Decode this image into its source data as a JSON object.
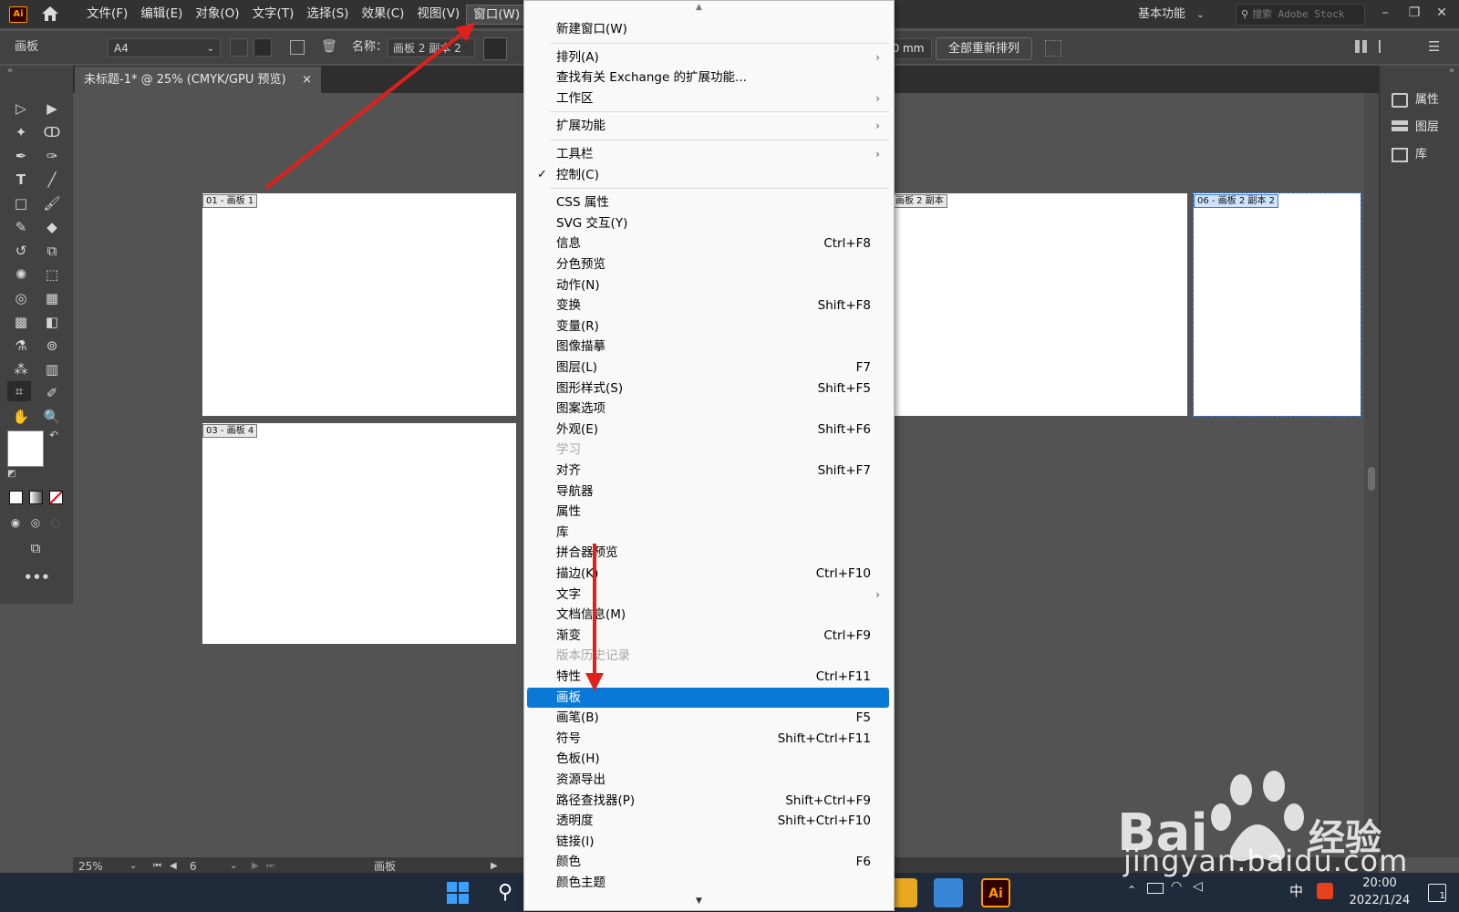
{
  "menubar": {
    "logo": "Ai",
    "items": [
      "文件(F)",
      "编辑(E)",
      "对象(O)",
      "文字(T)",
      "选择(S)",
      "效果(C)",
      "视图(V)",
      "窗口(W)"
    ],
    "workspace": "基本功能",
    "search_placeholder": "搜索 Adobe Stock"
  },
  "control_bar": {
    "label": "画板",
    "preset": "A4",
    "name_label": "名称：",
    "name_value": "画板 2 副本 2",
    "mm_value": "0 mm",
    "rearrange_button": "全部重新排列"
  },
  "document": {
    "tab_title": "未标题-1* @ 25% (CMYK/GPU 预览)",
    "close": "×"
  },
  "artboards": [
    {
      "label": "01 - 画板 1"
    },
    {
      "label": "03 - 画板 4"
    },
    {
      "label": "画板 2 副本"
    },
    {
      "label": "06 - 画板 2 副本 2"
    }
  ],
  "right_panel": {
    "items": [
      "属性",
      "图层",
      "库"
    ]
  },
  "status_bar": {
    "zoom": "25%",
    "page": "6",
    "mode": "画板"
  },
  "window_menu": {
    "rows": [
      {
        "label": "新建窗口(W)"
      },
      {
        "sep": true
      },
      {
        "label": "排列(A)",
        "sub": true
      },
      {
        "label": "查找有关 Exchange 的扩展功能..."
      },
      {
        "label": "工作区",
        "sub": true
      },
      {
        "sep": true
      },
      {
        "label": "扩展功能",
        "sub": true
      },
      {
        "sep": true
      },
      {
        "label": "工具栏",
        "sub": true
      },
      {
        "label": "控制(C)",
        "checked": true
      },
      {
        "sep": true
      },
      {
        "label": "CSS 属性"
      },
      {
        "label": "SVG 交互(Y)"
      },
      {
        "label": "信息",
        "shortcut": "Ctrl+F8"
      },
      {
        "label": "分色预览"
      },
      {
        "label": "动作(N)"
      },
      {
        "label": "变换",
        "shortcut": "Shift+F8"
      },
      {
        "label": "变量(R)"
      },
      {
        "label": "图像描摹"
      },
      {
        "label": "图层(L)",
        "shortcut": "F7"
      },
      {
        "label": "图形样式(S)",
        "shortcut": "Shift+F5"
      },
      {
        "label": "图案选项"
      },
      {
        "label": "外观(E)",
        "shortcut": "Shift+F6"
      },
      {
        "label": "学习",
        "disabled": true
      },
      {
        "label": "对齐",
        "shortcut": "Shift+F7"
      },
      {
        "label": "导航器"
      },
      {
        "label": "属性"
      },
      {
        "label": "库"
      },
      {
        "label": "拼合器预览"
      },
      {
        "label": "描边(K)",
        "shortcut": "Ctrl+F10"
      },
      {
        "label": "文字",
        "sub": true
      },
      {
        "label": "文档信息(M)"
      },
      {
        "label": "渐变",
        "shortcut": "Ctrl+F9"
      },
      {
        "label": "版本历史记录",
        "disabled": true
      },
      {
        "label": "特性",
        "shortcut": "Ctrl+F11"
      },
      {
        "label": "画板",
        "highlighted": true
      },
      {
        "label": "画笔(B)",
        "shortcut": "F5"
      },
      {
        "label": "符号",
        "shortcut": "Shift+Ctrl+F11"
      },
      {
        "label": "色板(H)"
      },
      {
        "label": "资源导出"
      },
      {
        "label": "路径查找器(P)",
        "shortcut": "Shift+Ctrl+F9"
      },
      {
        "label": "透明度",
        "shortcut": "Shift+Ctrl+F10"
      },
      {
        "label": "链接(I)"
      },
      {
        "label": "颜色",
        "shortcut": "F6"
      },
      {
        "label": "颜色主题"
      }
    ]
  },
  "taskbar": {
    "ime": "中",
    "time": "20:00",
    "date": "2022/1/24",
    "notification_count": "1"
  },
  "watermark": {
    "text": "jingyan.baidu.com"
  },
  "colors": {
    "highlight": "#0a78d7",
    "arrow": "#e0201a",
    "illustrator_orange": "#ff9a00"
  }
}
